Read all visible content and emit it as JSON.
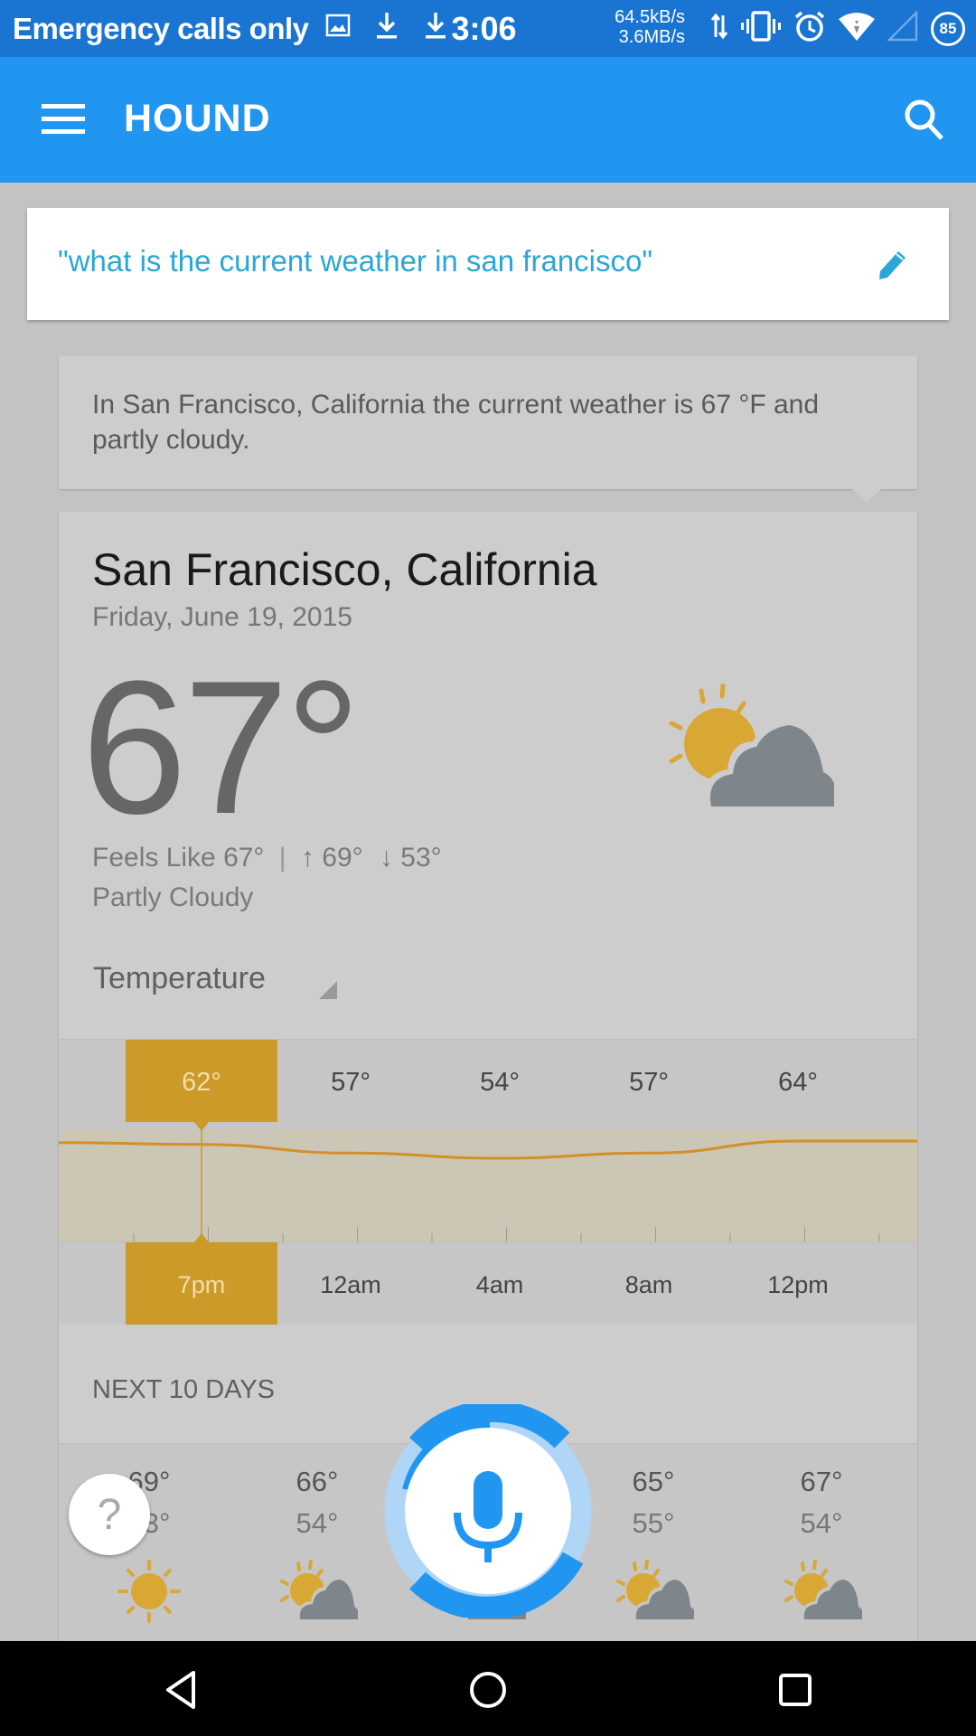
{
  "status_bar": {
    "carrier": "Emergency calls only",
    "icons": [
      "image-icon",
      "download-icon",
      "download-icon"
    ],
    "time": "3:06",
    "upload_speed": "64.5kB/s",
    "download_speed": "3.6MB/s",
    "right_icons": [
      "data-transfer-icon",
      "vibrate-icon",
      "alarm-icon",
      "wifi-icon",
      "cell-signal-icon"
    ],
    "battery": "85"
  },
  "app_bar": {
    "title": "HOUND",
    "menu_icon": "hamburger-menu-icon",
    "search_icon": "search-icon"
  },
  "query": {
    "text": "\"what is the current weather in san francisco\"",
    "edit_icon": "pencil-icon"
  },
  "answer": {
    "text": "In San Francisco, California the current weather is 67 °F and partly cloudy."
  },
  "weather": {
    "city": "San Francisco, California",
    "date": "Friday, June 19, 2015",
    "current_temp": "67°",
    "feels_like": "Feels Like 67°",
    "separator": "|",
    "high": "↑ 69°",
    "low": "↓ 53°",
    "condition": "Partly Cloudy",
    "condition_icon": "partly-cloudy-icon",
    "metric_selector": "Temperature",
    "hourly": {
      "selected_index": 0,
      "temps": [
        "62°",
        "57°",
        "54°",
        "57°",
        "64°"
      ],
      "times": [
        "7pm",
        "12am",
        "4am",
        "8am",
        "12pm"
      ],
      "accent_color": "#cc9a28"
    },
    "next_days_label": "NEXT 10 DAYS",
    "days": [
      {
        "hi": "69°",
        "lo": "53°",
        "icon": "sunny-icon"
      },
      {
        "hi": "66°",
        "lo": "54°",
        "icon": "partly-cloudy-icon"
      },
      {
        "hi": "",
        "lo": "",
        "icon": "partly-cloudy-icon"
      },
      {
        "hi": "65°",
        "lo": "55°",
        "icon": "partly-cloudy-icon"
      },
      {
        "hi": "67°",
        "lo": "54°",
        "icon": "partly-cloudy-icon"
      }
    ]
  },
  "chart_data": {
    "type": "area",
    "title": "Temperature",
    "x": [
      "7pm",
      "12am",
      "4am",
      "8am",
      "12pm"
    ],
    "series": [
      {
        "name": "Temperature",
        "values": [
          62,
          57,
          54,
          57,
          64
        ]
      }
    ],
    "xlabel": "",
    "ylabel": ""
  },
  "fab": {
    "help_label": "?",
    "mic_icon": "microphone-icon"
  },
  "nav_bar": {
    "back": "back-icon",
    "home": "home-icon",
    "recents": "recents-icon"
  },
  "colors": {
    "primary": "#2196f0",
    "status_bar": "#1a74d2",
    "query_text": "#2ba6d6",
    "accent": "#cc9a28"
  }
}
